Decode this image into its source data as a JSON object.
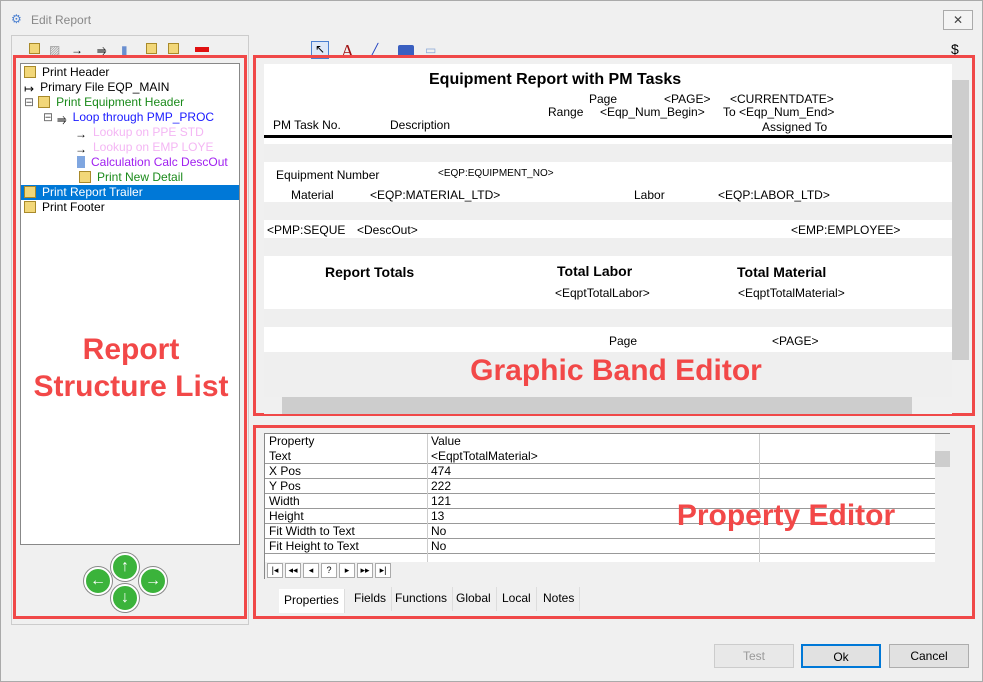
{
  "window": {
    "title": "Edit Report",
    "close": "✕"
  },
  "tree": {
    "nodes": [
      {
        "label": "Print Header",
        "color": "#000000",
        "icon": "band-icon"
      },
      {
        "label": "Primary File EQP_MAIN",
        "color": "#000000",
        "icon": "file-arrow-icon"
      },
      {
        "label": "Print Equipment Header",
        "color": "#1a8a1a",
        "icon": "band-icon"
      },
      {
        "label": "Loop through  PMP_PROC",
        "color": "#1a1aff",
        "icon": "loop-icon"
      },
      {
        "label": "Lookup on PPE STD",
        "color": "#f4b6f4",
        "icon": "arrow-icon"
      },
      {
        "label": "Lookup on EMP LOYE",
        "color": "#f4b6f4",
        "icon": "arrow-icon"
      },
      {
        "label": "Calculation Calc DescOut",
        "color": "#a020f0",
        "icon": "calc-icon"
      },
      {
        "label": "Print New Detail",
        "color": "#1a8a1a",
        "icon": "band-icon"
      },
      {
        "label": "Print Report Trailer",
        "color": "#ffffff",
        "icon": "band-icon"
      },
      {
        "label": "Print Footer",
        "color": "#000000",
        "icon": "band-icon"
      }
    ]
  },
  "annotations": {
    "left": "Report Structure List",
    "band": "Graphic Band Editor",
    "prop": "Property Editor"
  },
  "report": {
    "title": "Equipment Report with PM Tasks",
    "page": "Page",
    "page_field": "<PAGE>",
    "date": "<CURRENTDATE>",
    "range": "Range",
    "begin": "<Eqp_Num_Begin>",
    "to": "To <Eqp_Num_End>",
    "pm_task": "PM Task No.",
    "description": "Description",
    "assigned": "Assigned To",
    "equip_label": "Equipment Number",
    "equip_field": "<EQP:EQUIPMENT_NO>",
    "material_label": "Material",
    "material_field": "<EQP:MATERIAL_LTD>",
    "labor_label": "Labor",
    "labor_field": "<EQP:LABOR_LTD>",
    "seq": "<PMP:SEQUE",
    "descout": "<DescOut>",
    "employee": "<EMP:EMPLOYEE>",
    "totals": "Report Totals",
    "total_labor": "Total Labor",
    "total_material": "Total Material",
    "total_labor_field": "<EqptTotalLabor>",
    "total_material_field": "<EqptTotalMaterial>",
    "footer_page": "Page",
    "footer_page_field": "<PAGE>"
  },
  "toolbar": {
    "dollar": "$"
  },
  "properties": {
    "header": [
      "Property",
      "Value"
    ],
    "rows": [
      [
        "Text",
        "<EqptTotalMaterial>"
      ],
      [
        "X Pos",
        "474"
      ],
      [
        "Y Pos",
        "222"
      ],
      [
        "Width",
        "121"
      ],
      [
        "Height",
        "13"
      ],
      [
        "Fit Width to Text",
        "No"
      ],
      [
        "Fit Height to Text",
        "No"
      ]
    ],
    "nav": [
      "|◂",
      "◂◂",
      "◂",
      "?",
      "▸",
      "▸▸",
      "▸|"
    ]
  },
  "tabs": [
    "Properties",
    "Fields",
    "Functions",
    "Global",
    "Local",
    "Notes"
  ],
  "buttons": {
    "test": "Test",
    "ok": "Ok",
    "cancel": "Cancel"
  }
}
